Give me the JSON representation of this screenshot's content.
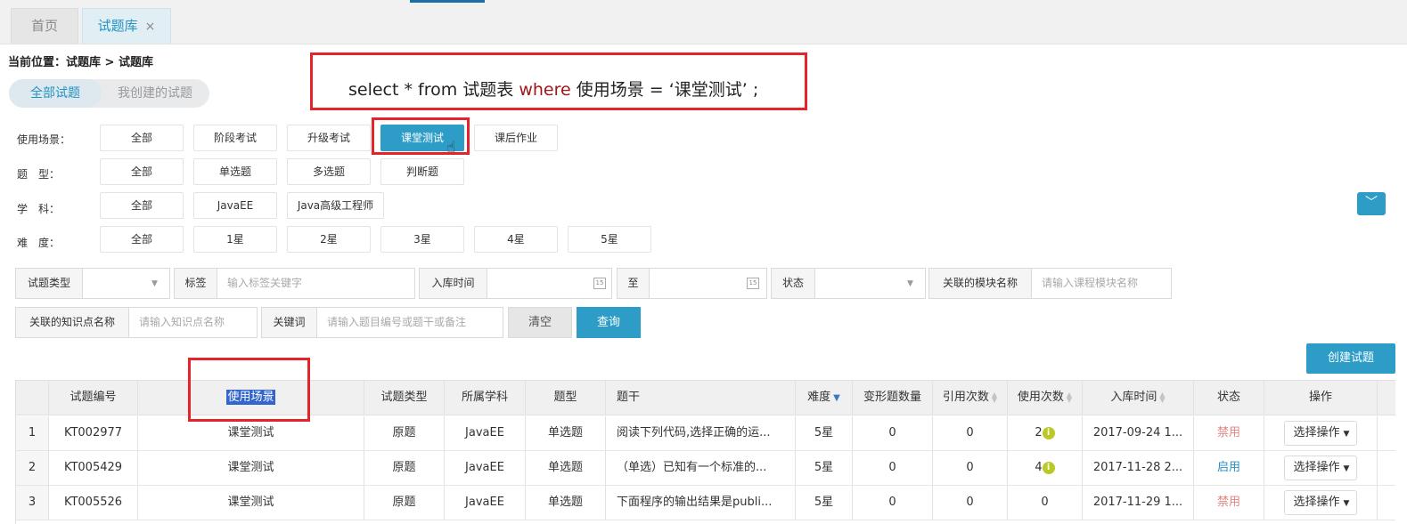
{
  "tabs": [
    {
      "label": "首页"
    },
    {
      "label": "试题库",
      "close": "×"
    }
  ],
  "breadcrumb": "当前位置：试题库 > 试题库",
  "sql_overlay": {
    "part1": "select * from 试题表 ",
    "keyword": "where",
    "part2": " 使用场景 = ‘课堂测试’ ;"
  },
  "subtabs": [
    "全部试题",
    "我创建的试题"
  ],
  "filters": {
    "scene": {
      "label": "使用场景：",
      "options": [
        "全部",
        "阶段考试",
        "升级考试",
        "课堂测试",
        "课后作业"
      ],
      "selected": "课堂测试"
    },
    "type": {
      "label": "题　型：",
      "options": [
        "全部",
        "单选题",
        "多选题",
        "判断题"
      ]
    },
    "subject": {
      "label": "学　科：",
      "options": [
        "全部",
        "JavaEE",
        "Java高级工程师"
      ]
    },
    "difficulty": {
      "label": "难　度：",
      "options": [
        "全部",
        "1星",
        "2星",
        "3星",
        "4星",
        "5星"
      ]
    }
  },
  "search": {
    "qtype_label": "试题类型",
    "tag_label": "标签",
    "tag_placeholder": "输入标签关键字",
    "date_label": "入库时间",
    "to_label": "至",
    "status_label": "状态",
    "module_label": "关联的模块名称",
    "module_placeholder": "请输入课程模块名称",
    "knowledge_label": "关联的知识点名称",
    "knowledge_placeholder": "请输入知识点名称",
    "keyword_label": "关键词",
    "keyword_placeholder": "请输入题目编号或题干或备注",
    "clear": "清空",
    "query": "查询",
    "calendar_glyph": "15"
  },
  "create_button": "创建试题",
  "table": {
    "headers": [
      "试题编号",
      "使用场景",
      "试题类型",
      "所属学科",
      "题型",
      "题干",
      "难度",
      "变形题数量",
      "引用次数",
      "使用次数",
      "入库时间",
      "状态",
      "操作"
    ],
    "rows": [
      {
        "no": "1",
        "id": "KT002977",
        "scene": "课堂测试",
        "qtype": "原题",
        "subject": "JavaEE",
        "kind": "单选题",
        "stem": "阅读下列代码,选择正确的运...",
        "diff": "5星",
        "variants": "0",
        "refs": "0",
        "uses": "2",
        "date": "2017-09-24 1...",
        "status": "禁用",
        "status_kind": "off",
        "op": "选择操作"
      },
      {
        "no": "2",
        "id": "KT005429",
        "scene": "课堂测试",
        "qtype": "原题",
        "subject": "JavaEE",
        "kind": "单选题",
        "stem": "（单选）已知有一个标准的...",
        "diff": "5星",
        "variants": "0",
        "refs": "0",
        "uses": "4",
        "date": "2017-11-28 2...",
        "status": "启用",
        "status_kind": "on",
        "op": "选择操作"
      },
      {
        "no": "3",
        "id": "KT005526",
        "scene": "课堂测试",
        "qtype": "原题",
        "subject": "JavaEE",
        "kind": "单选题",
        "stem": "下面程序的输出结果是publi...",
        "diff": "5星",
        "variants": "0",
        "refs": "0",
        "uses": "0",
        "date": "2017-11-29 1...",
        "status": "禁用",
        "status_kind": "off",
        "op": "选择操作"
      }
    ]
  },
  "colors": {
    "accent": "#2d9dc8",
    "highlight_box": "#e3242b",
    "status_disabled": "#e8827f",
    "status_enabled": "#2492c2"
  }
}
